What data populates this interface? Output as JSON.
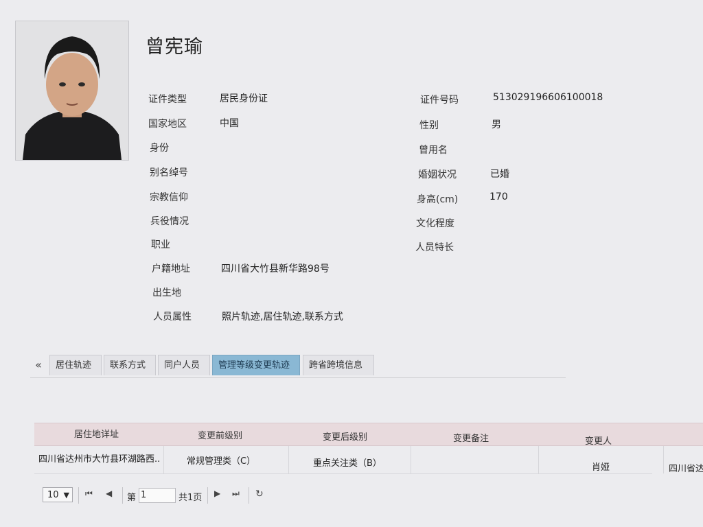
{
  "person": {
    "name": "曾宪瑜"
  },
  "fields_left": [
    {
      "label": "证件类型",
      "value": "居民身份证"
    },
    {
      "label": "国家地区",
      "value": "中国"
    },
    {
      "label": "身份",
      "value": ""
    },
    {
      "label": "别名绰号",
      "value": ""
    },
    {
      "label": "宗教信仰",
      "value": ""
    },
    {
      "label": "兵役情况",
      "value": ""
    },
    {
      "label": "职业",
      "value": ""
    },
    {
      "label": "户籍地址",
      "value": "四川省大竹县新华路98号"
    },
    {
      "label": "出生地",
      "value": ""
    },
    {
      "label": "人员属性",
      "value": "照片轨迹,居住轨迹,联系方式"
    }
  ],
  "fields_right": [
    {
      "label": "证件号码",
      "value": "513029196606100018"
    },
    {
      "label": "性别",
      "value": "男"
    },
    {
      "label": "曾用名",
      "value": ""
    },
    {
      "label": "婚姻状况",
      "value": "已婚"
    },
    {
      "label": "身高(cm)",
      "value": "170"
    },
    {
      "label": "文化程度",
      "value": ""
    },
    {
      "label": "人员特长",
      "value": ""
    }
  ],
  "tabs": {
    "nav_label": "«",
    "items": [
      "居住轨迹",
      "联系方式",
      "同户人员",
      "管理等级变更轨迹",
      "跨省跨境信息"
    ],
    "active_index": 3
  },
  "grid": {
    "headers": [
      "居住地详址",
      "变更前级别",
      "变更后级别",
      "变更备注",
      "变更人"
    ],
    "rows": [
      [
        "四川省达州市大竹县环湖路西...",
        "常规管理类（C）",
        "重点关注类（B）",
        "",
        "肖娅",
        "四川省达"
      ]
    ]
  },
  "pager": {
    "page_size": "10",
    "page_prefix": "第",
    "page_value": "1",
    "total_pages": "共1页"
  }
}
